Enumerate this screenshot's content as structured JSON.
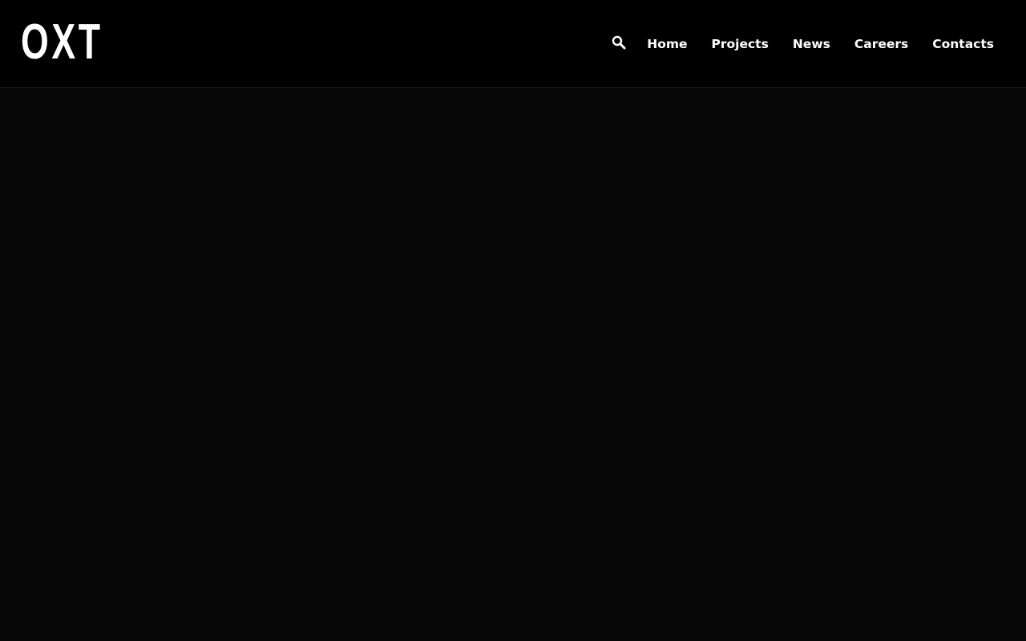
{
  "brand": {
    "logo_text": "OXT"
  },
  "nav": {
    "search_icon": "search-icon",
    "items": [
      {
        "label": "Home"
      },
      {
        "label": "Projects"
      },
      {
        "label": "News"
      },
      {
        "label": "Careers"
      },
      {
        "label": "Contacts"
      }
    ]
  },
  "colors": {
    "header_background": "#000000",
    "page_background": "#080808",
    "text": "#ffffff"
  }
}
